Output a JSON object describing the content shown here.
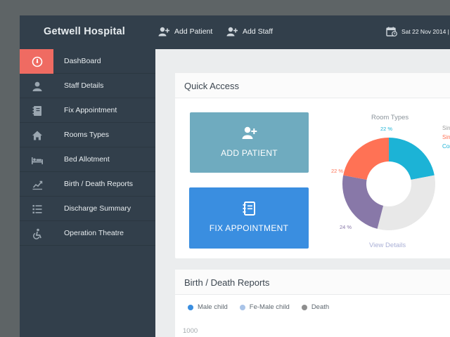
{
  "header": {
    "brand": "Getwell Hospital",
    "add_patient": "Add Patient",
    "add_staff": "Add Staff",
    "date": "Sat 22 Nov 2014 |"
  },
  "sidebar": {
    "items": [
      {
        "label": "DashBoard",
        "icon": "dashboard-icon",
        "active": true
      },
      {
        "label": "Staff Details",
        "icon": "user-icon"
      },
      {
        "label": "Fix Appointment",
        "icon": "notebook-icon"
      },
      {
        "label": "Rooms Types",
        "icon": "home-icon"
      },
      {
        "label": "Bed Allotment",
        "icon": "bed-icon"
      },
      {
        "label": "Birth / Death Reports",
        "icon": "chart-icon"
      },
      {
        "label": "Discharge Summary",
        "icon": "list-icon"
      },
      {
        "label": "Operation Theatre",
        "icon": "wheelchair-icon"
      }
    ]
  },
  "quick_access": {
    "title": "Quick Access",
    "add_patient": "ADD PATIENT",
    "fix_appointment": "FIX APPOINTMENT",
    "room_types": {
      "title": "Room  Types",
      "view_details": "View Details",
      "legend": [
        "Singl",
        "Singl",
        "Comi"
      ]
    }
  },
  "reports": {
    "title": "Birth / Death Reports",
    "legend": [
      "Male child",
      "Fe-Male child",
      "Death"
    ],
    "ytick_top": "1000"
  },
  "colors": {
    "sidebar": "#323f4b",
    "active": "#ef6b62",
    "teal_tile": "#6fabbf",
    "blue_tile": "#3a8ee0",
    "male": "#3a8ee0",
    "female": "#a9c4e8",
    "death": "#8f8f8f"
  },
  "chart_data": {
    "type": "pie",
    "title": "Room  Types",
    "slices": [
      {
        "label": "22 %",
        "value": 22,
        "color": "#1cb3d6"
      },
      {
        "label": "22 %",
        "value": 22,
        "color": "#ff7255"
      },
      {
        "label": "24 %",
        "value": 24,
        "color": "#8878a8"
      },
      {
        "label": "",
        "value": 32,
        "color": "#e8e8e8"
      }
    ]
  }
}
